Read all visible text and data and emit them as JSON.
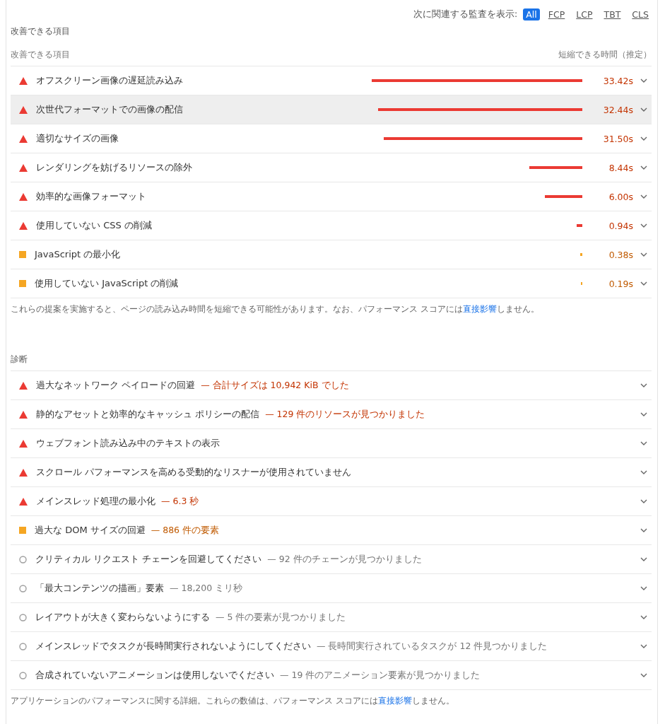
{
  "filter": {
    "label": "次に関連する監査を表示:",
    "chips": [
      {
        "label": "All",
        "selected": true
      },
      {
        "label": "FCP",
        "selected": false
      },
      {
        "label": "LCP",
        "selected": false
      },
      {
        "label": "TBT",
        "selected": false
      },
      {
        "label": "CLS",
        "selected": false
      }
    ]
  },
  "opportunities": {
    "title": "改善できる項目",
    "column_left": "改善できる項目",
    "column_right": "短縮できる時間（推定）",
    "rows": [
      {
        "kind": "fail",
        "title": "オフスクリーン画像の遅延読み込み",
        "savings": "33.42s",
        "highlighted": false
      },
      {
        "kind": "fail",
        "title": "次世代フォーマットでの画像の配信",
        "savings": "32.44s",
        "highlighted": true
      },
      {
        "kind": "fail",
        "title": "適切なサイズの画像",
        "savings": "31.50s",
        "highlighted": false
      },
      {
        "kind": "fail",
        "title": "レンダリングを妨げるリソースの除外",
        "savings": "8.44s",
        "highlighted": false
      },
      {
        "kind": "fail",
        "title": "効率的な画像フォーマット",
        "savings": "6.00s",
        "highlighted": false
      },
      {
        "kind": "fail",
        "title": "使用していない CSS の削減",
        "savings": "0.94s",
        "highlighted": false
      },
      {
        "kind": "average",
        "title": "JavaScript の最小化",
        "savings": "0.38s",
        "highlighted": false
      },
      {
        "kind": "average",
        "title": "使用していない JavaScript の削減",
        "savings": "0.19s",
        "highlighted": false
      }
    ],
    "note": {
      "before": "これらの提案を実施すると、ページの読み込み時間を短縮できる可能性があります。なお、パフォーマンス スコアには",
      "link": "直接影響",
      "after": "しません。"
    }
  },
  "diagnostics": {
    "title": "診断",
    "rows": [
      {
        "kind": "fail",
        "title": "過大なネットワーク ペイロードの回避",
        "detail": "— 合計サイズは 10,942 KiB でした"
      },
      {
        "kind": "fail",
        "title": "静的なアセットと効率的なキャッシュ ポリシーの配信",
        "detail": "— 129 件のリソースが見つかりました"
      },
      {
        "kind": "fail",
        "title": "ウェブフォント読み込み中のテキストの表示"
      },
      {
        "kind": "fail",
        "title": "スクロール パフォーマンスを高める受動的なリスナーが使用されていません"
      },
      {
        "kind": "fail",
        "title": "メインスレッド処理の最小化",
        "detail": "— 6.3 秒"
      },
      {
        "kind": "average",
        "title": "過大な DOM サイズの回避",
        "detail": "— 886 件の要素"
      },
      {
        "kind": "info",
        "title": "クリティカル リクエスト チェーンを回避してください",
        "detail": "— 92 件のチェーンが見つかりました"
      },
      {
        "kind": "info",
        "title": "「最大コンテンツの描画」要素",
        "detail": "— 18,200 ミリ秒"
      },
      {
        "kind": "info",
        "title": "レイアウトが大きく変わらないようにする",
        "detail": "— 5 件の要素が見つかりました"
      },
      {
        "kind": "info",
        "title": "メインスレッドでタスクが長時間実行されないようにしてください",
        "detail": "— 長時間実行されているタスクが 12 件見つかりました"
      },
      {
        "kind": "info",
        "title": "合成されていないアニメーションは使用しないでください",
        "detail": "— 19 件のアニメーション要素が見つかりました"
      }
    ],
    "note": {
      "before": "アプリケーションのパフォーマンスに関する詳細。これらの数値は、パフォーマンス スコアには",
      "link": "直接影響",
      "after": "しません。"
    }
  }
}
